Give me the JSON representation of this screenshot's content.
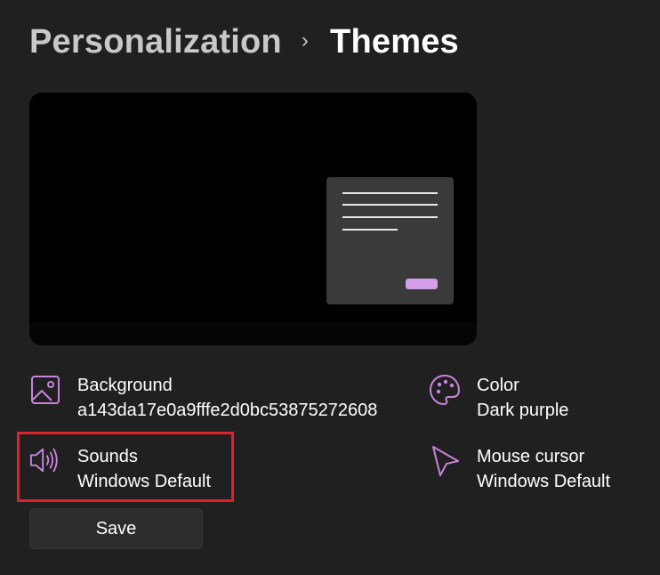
{
  "breadcrumb": {
    "parent": "Personalization",
    "separator": "›",
    "current": "Themes"
  },
  "theme": {
    "accent_color": "#d59ee8",
    "icon_color": "#c784dc",
    "highlight_color": "#e0202a"
  },
  "properties": {
    "background": {
      "icon": "image-icon",
      "label": "Background",
      "value": "a143da17e0a9fffe2d0bc53875272608"
    },
    "color": {
      "icon": "palette-icon",
      "label": "Color",
      "value": "Dark purple"
    },
    "sounds": {
      "icon": "speaker-icon",
      "label": "Sounds",
      "value": "Windows Default"
    },
    "mouse_cursor": {
      "icon": "cursor-icon",
      "label": "Mouse cursor",
      "value": "Windows Default"
    }
  },
  "save_button": {
    "label": "Save"
  }
}
